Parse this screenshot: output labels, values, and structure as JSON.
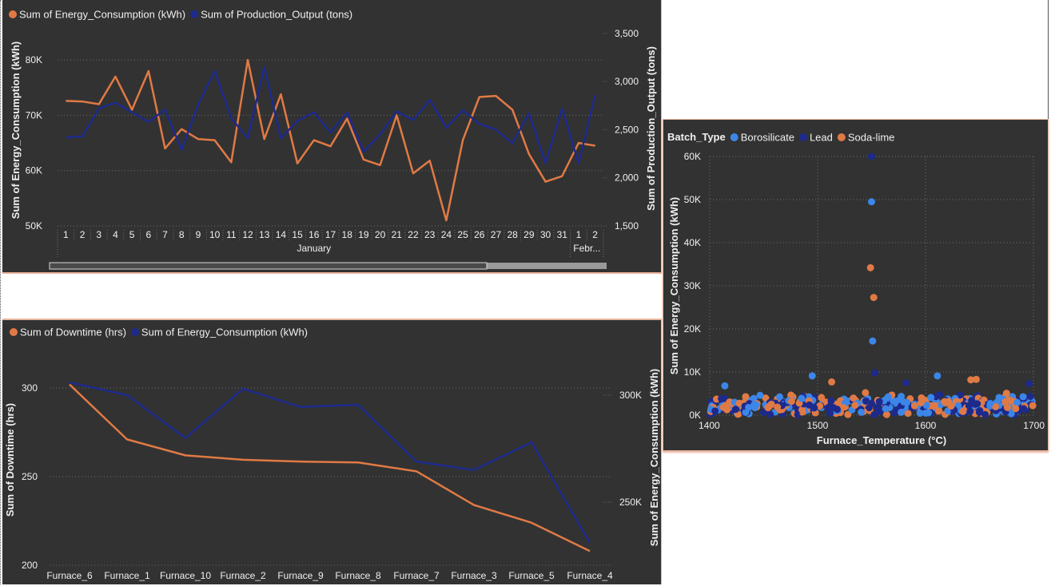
{
  "chart_data": [
    {
      "type": "line",
      "legend": [
        {
          "name": "Sum of Energy_Consumption (kWh)",
          "color": "#e07a45"
        },
        {
          "name": "Sum of Production_Output (tons)",
          "color": "#1d2a8c"
        }
      ],
      "ylabel": "Sum of Energy_Consumption (kWh)",
      "y2label": "Sum of Production_Output (tons)",
      "ylim": [
        50000,
        80000
      ],
      "y2lim": [
        1500,
        3500
      ],
      "yticks": [
        "50K",
        "60K",
        "70K",
        "80K"
      ],
      "y2ticks": [
        "1,500",
        "2,000",
        "2,500",
        "3,000",
        "3,500"
      ],
      "categories": [
        "1",
        "2",
        "3",
        "4",
        "5",
        "6",
        "7",
        "8",
        "9",
        "10",
        "11",
        "12",
        "13",
        "14",
        "15",
        "16",
        "17",
        "18",
        "19",
        "20",
        "21",
        "22",
        "23",
        "24",
        "25",
        "26",
        "27",
        "28",
        "29",
        "30",
        "31",
        "1",
        "2"
      ],
      "groups": [
        {
          "label": "January",
          "from": 0,
          "to": 30
        },
        {
          "label": "Febr...",
          "from": 31,
          "to": 32
        }
      ],
      "series": [
        {
          "name": "Sum of Energy_Consumption (kWh)",
          "axis": "left",
          "values": [
            72600,
            72500,
            72000,
            77000,
            71000,
            78000,
            64000,
            67500,
            65700,
            65500,
            61500,
            80000,
            65700,
            73800,
            61300,
            65500,
            64400,
            69400,
            62000,
            61000,
            70000,
            59500,
            61800,
            51000,
            65500,
            73300,
            73500,
            71000,
            63000,
            58000,
            59000,
            65000,
            64500
          ]
        },
        {
          "name": "Sum of Production_Output (tons)",
          "axis": "right",
          "values": [
            2420,
            2430,
            2720,
            2780,
            2680,
            2580,
            2710,
            2290,
            2760,
            3110,
            2620,
            2410,
            3150,
            2410,
            2590,
            2680,
            2470,
            2680,
            2270,
            2450,
            2690,
            2600,
            2810,
            2520,
            2700,
            2560,
            2500,
            2360,
            2670,
            2150,
            2720,
            2150,
            2860
          ]
        }
      ]
    },
    {
      "type": "line",
      "legend": [
        {
          "name": "Sum of Downtime (hrs)",
          "color": "#e07a45"
        },
        {
          "name": "Sum of Energy_Consumption (kWh)",
          "color": "#1d2a8c"
        }
      ],
      "ylabel": "Sum of Downtime (hrs)",
      "y2label": "Sum of Energy_Consumption (kWh)",
      "ylim": [
        200,
        310
      ],
      "y2lim": [
        227000,
        315000
      ],
      "yticks": [
        "200",
        "250",
        "300"
      ],
      "y2ticks": [
        "250K",
        "300K"
      ],
      "categories": [
        "Furnace_6",
        "Furnace_1",
        "Furnace_10",
        "Furnace_2",
        "Furnace_9",
        "Furnace_8",
        "Furnace_7",
        "Furnace_3",
        "Furnace_5",
        "Furnace_4"
      ],
      "series": [
        {
          "name": "Sum of Downtime (hrs)",
          "axis": "left",
          "values": [
            302,
            271,
            262,
            259.5,
            258.5,
            258,
            253,
            234,
            224,
            208
          ]
        },
        {
          "name": "Sum of Energy_Consumption (kWh)",
          "axis": "right",
          "values": [
            306000,
            300000,
            280000,
            303000,
            294500,
            295500,
            269000,
            265000,
            278000,
            231000
          ]
        }
      ]
    },
    {
      "type": "scatter",
      "legend_title": "Batch_Type",
      "legend": [
        {
          "name": "Borosilicate",
          "color": "#3c86e8"
        },
        {
          "name": "Lead",
          "color": "#1d2a8c"
        },
        {
          "name": "Soda-lime",
          "color": "#e07a45"
        }
      ],
      "xlabel": "Furnace_Temperature (°C)",
      "ylabel": "Sum of Energy_Consumption (kWh)",
      "xlim": [
        1400,
        1700
      ],
      "ylim": [
        0,
        60000
      ],
      "xticks": [
        "1400",
        "1500",
        "1600",
        "1700"
      ],
      "yticks": [
        "0K",
        "10K",
        "20K",
        "30K",
        "40K",
        "50K",
        "60K"
      ],
      "highlight_points": [
        {
          "series": "Lead",
          "x": 1550,
          "y": 60000
        },
        {
          "series": "Borosilicate",
          "x": 1550,
          "y": 49500
        },
        {
          "series": "Soda-lime",
          "x": 1549,
          "y": 34200
        },
        {
          "series": "Soda-lime",
          "x": 1552,
          "y": 27300
        },
        {
          "series": "Borosilicate",
          "x": 1551,
          "y": 17200
        },
        {
          "series": "Lead",
          "x": 1553,
          "y": 9800
        },
        {
          "series": "Borosilicate",
          "x": 1495,
          "y": 9100
        },
        {
          "series": "Borosilicate",
          "x": 1611,
          "y": 9100
        },
        {
          "series": "Soda-lime",
          "x": 1642,
          "y": 8200
        },
        {
          "series": "Soda-lime",
          "x": 1647,
          "y": 8300
        },
        {
          "series": "Soda-lime",
          "x": 1513,
          "y": 7700
        },
        {
          "series": "Lead",
          "x": 1582,
          "y": 7500
        },
        {
          "series": "Borosilicate",
          "x": 1414,
          "y": 6800
        },
        {
          "series": "Lead",
          "x": 1696,
          "y": 7300
        }
      ],
      "cluster": {
        "count_per_series": 150,
        "y_range": [
          0,
          7000
        ]
      }
    }
  ]
}
